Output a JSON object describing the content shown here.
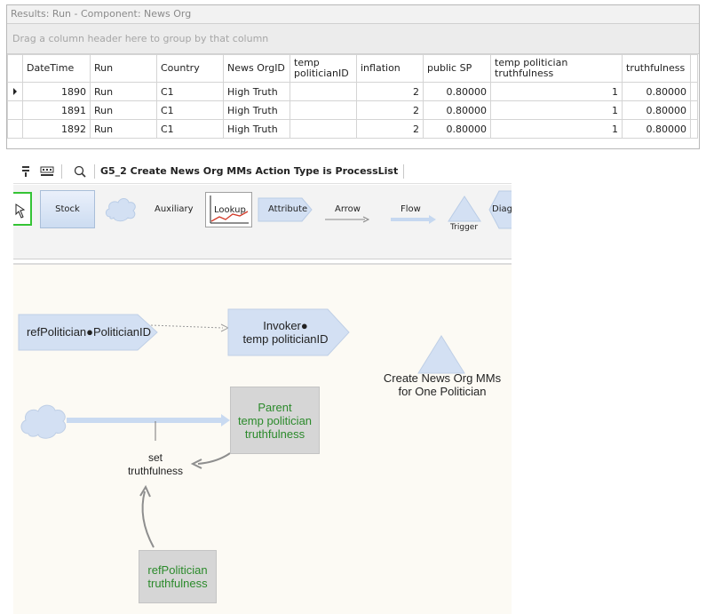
{
  "results": {
    "title": "Results: Run - Component: News Org",
    "group_hint": "Drag a column header here to group by that column",
    "columns": [
      {
        "label": "DateTime"
      },
      {
        "label": "Run"
      },
      {
        "label": "Country"
      },
      {
        "label": "News OrgID"
      },
      {
        "label": "temp politicianID"
      },
      {
        "label": "inflation"
      },
      {
        "label": "public SP"
      },
      {
        "label": "temp politician truthfulness"
      },
      {
        "label": "truthfulness"
      }
    ],
    "rows": [
      [
        "1890",
        "Run",
        "C1",
        "High Truth",
        "",
        "2",
        "0.80000",
        "1",
        "0.80000"
      ],
      [
        "1891",
        "Run",
        "C1",
        "High Truth",
        "",
        "2",
        "0.80000",
        "1",
        "0.80000"
      ],
      [
        "1892",
        "Run",
        "C1",
        "High Truth",
        "",
        "2",
        "0.80000",
        "1",
        "0.80000"
      ]
    ]
  },
  "toolbar": {
    "caption": "G5_2 Create News Org MMs  Action Type is ProcessList",
    "icons": [
      "filter-icon",
      "grid-icon",
      "zoom-icon"
    ]
  },
  "palette": {
    "items": {
      "stock": "Stock",
      "auxiliary": "Auxiliary",
      "lookup": "Lookup",
      "attribute": "Attribute",
      "arrow": "Arrow",
      "flow": "Flow",
      "trigger": "Trigger",
      "diagram": "Diagr"
    }
  },
  "canvas": {
    "ref_politician_id": "refPolitician●PoliticianID",
    "invoker_line1": "Invoker●",
    "invoker_line2": "temp politicianID",
    "trigger_line1": "Create News Org MMs",
    "trigger_line2": "for One Politician",
    "parent_line1": "Parent",
    "parent_line2": "temp politician",
    "parent_line3": "truthfulness",
    "set_line1": "set",
    "set_line2": "truthfulness",
    "refpol_line1": "refPolitician",
    "refpol_line2": "truthfulness"
  },
  "colors": {
    "accent_green": "#2b8a2b",
    "shape_blue": "#d3e0f3",
    "canvas_bg": "#fcfaf4"
  }
}
